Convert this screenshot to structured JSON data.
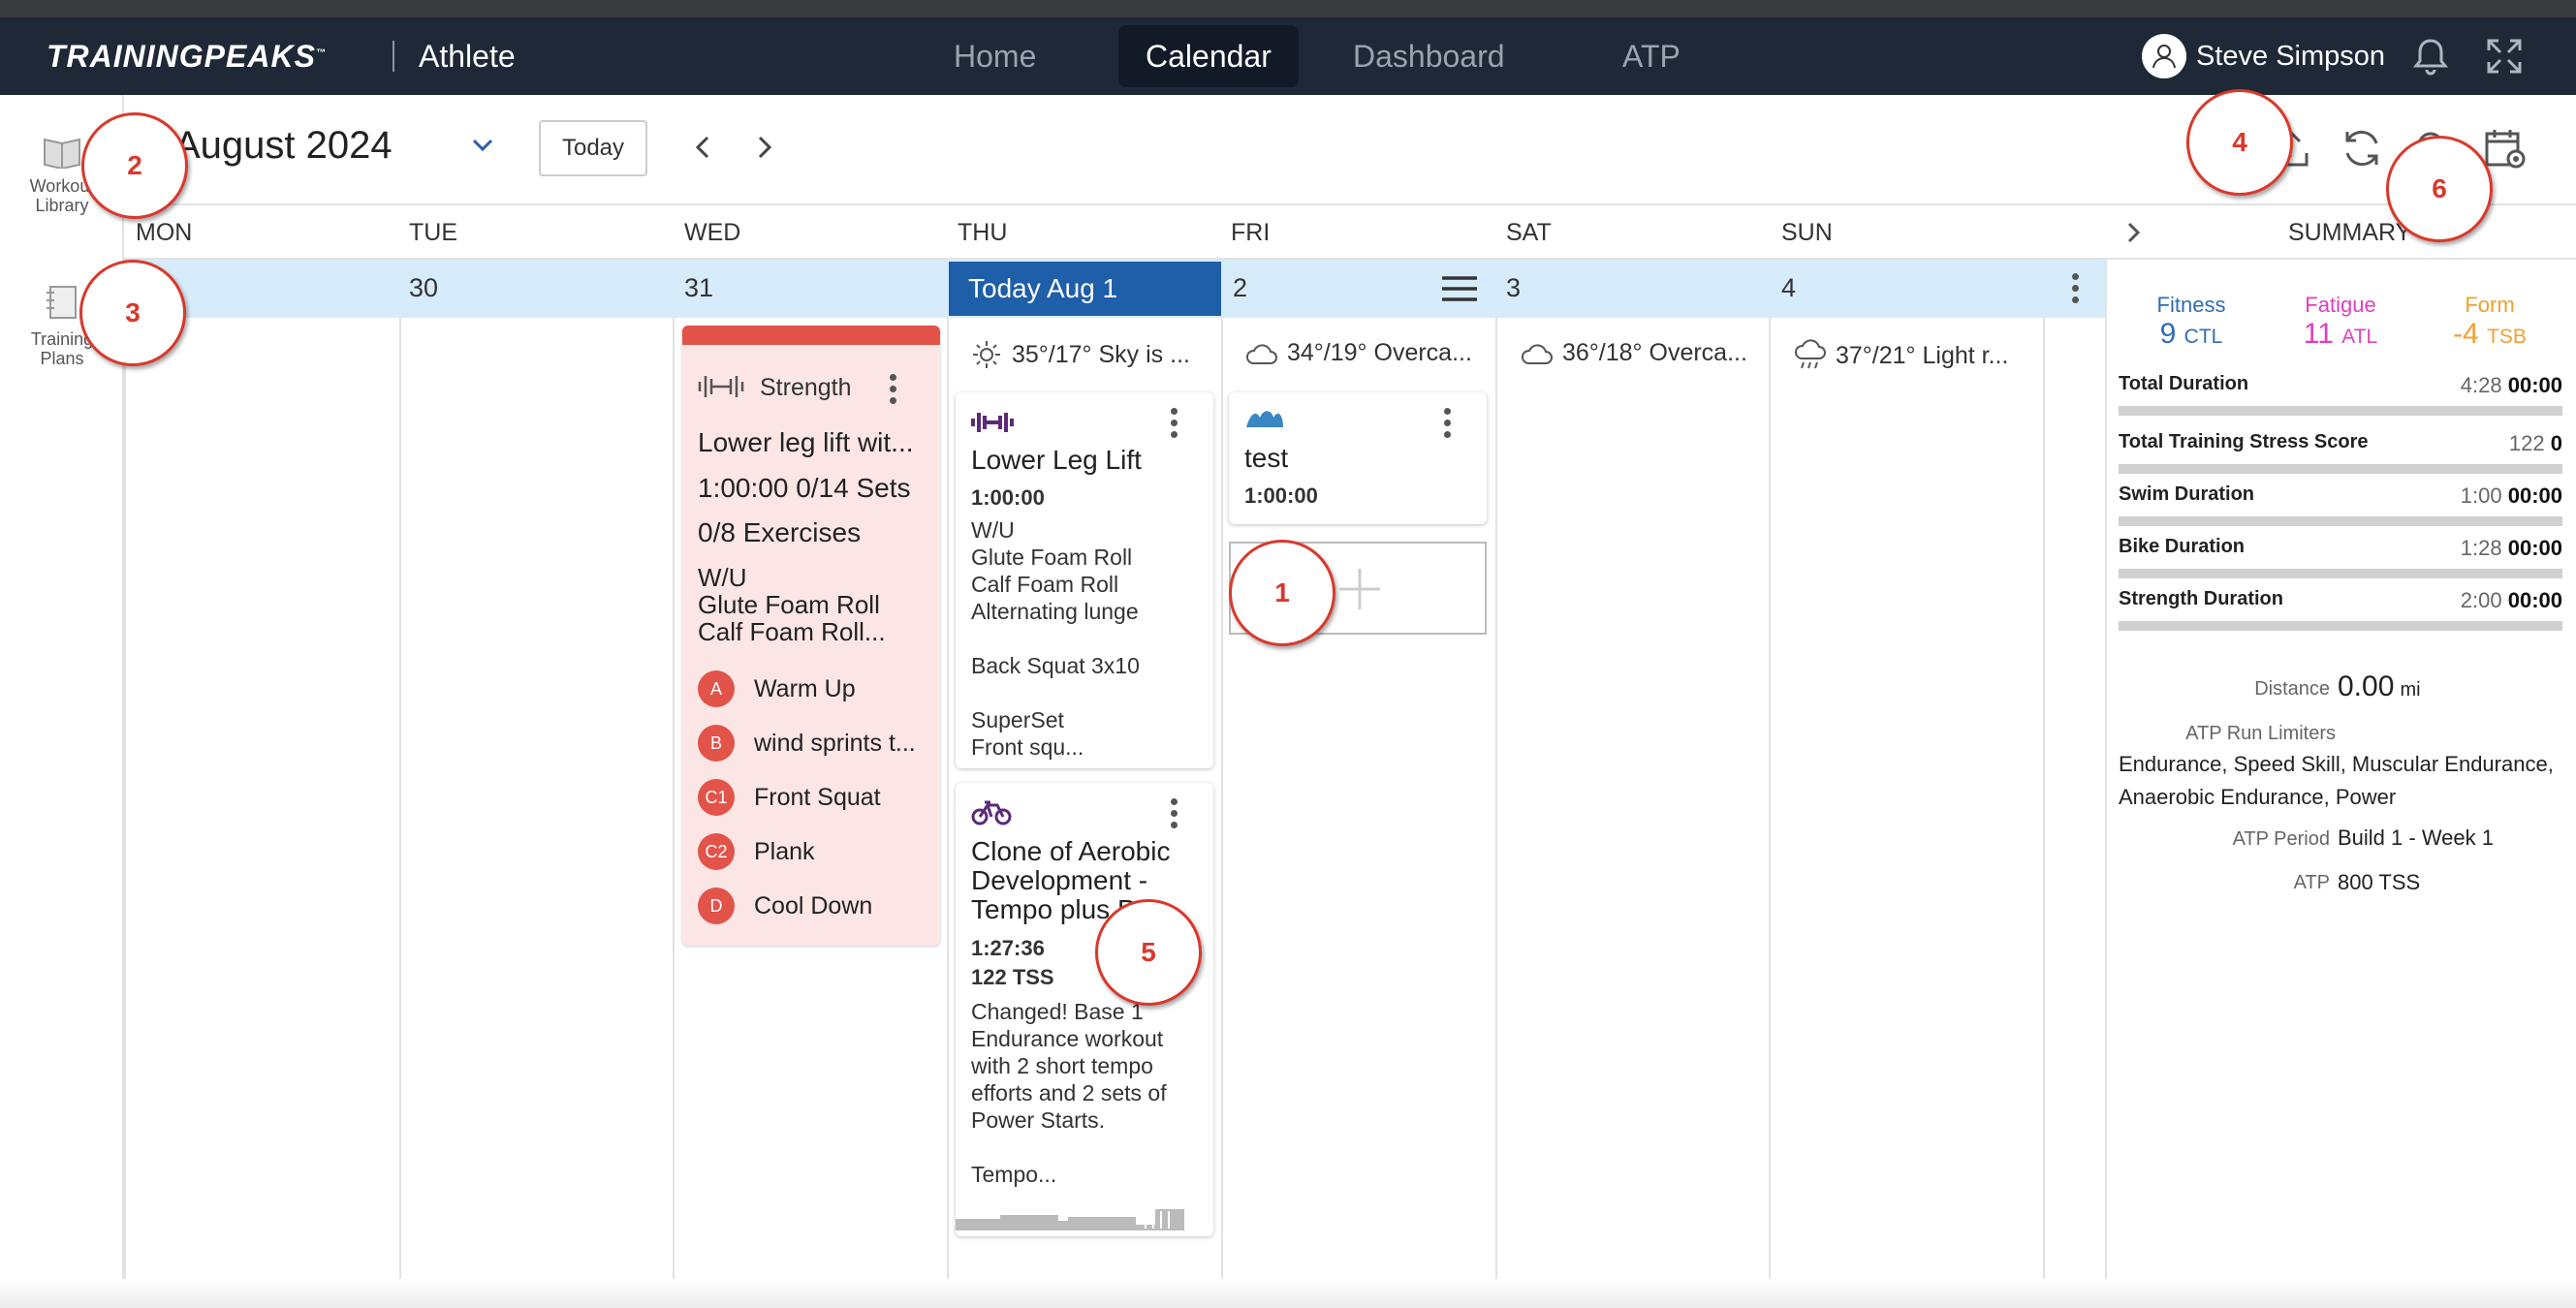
{
  "app": {
    "logo": "TRAININGPEAKS",
    "logo_tm": "™",
    "section": "Athlete"
  },
  "nav": {
    "home": "Home",
    "calendar": "Calendar",
    "dashboard": "Dashboard",
    "atp": "ATP"
  },
  "user": {
    "name": "Steve Simpson"
  },
  "sidebar": {
    "workout_library_1": "Workout",
    "workout_library_2": "Library",
    "training_plans_1": "Training",
    "training_plans_2": "Plans"
  },
  "toolbar": {
    "month": "August 2024",
    "today": "Today"
  },
  "days": {
    "mon": "MON",
    "tue": "TUE",
    "wed": "WED",
    "thu": "THU",
    "fri": "FRI",
    "sat": "SAT",
    "sun": "SUN",
    "summary": "SUMMARY"
  },
  "dates": {
    "tue": "30",
    "wed": "31",
    "thu": "Today Aug 1",
    "fri": "2",
    "sat": "3",
    "sun": "4"
  },
  "weather": {
    "thu": "35°/17° Sky is ...",
    "fri": "34°/19° Overca...",
    "sat": "36°/18° Overca...",
    "sun": "37°/21° Light r..."
  },
  "strength_card": {
    "type": "Strength",
    "title": "Lower leg lift wit...",
    "sets": "1:00:00 0/14 Sets",
    "exercises": "0/8 Exercises",
    "desc1": "W/U",
    "desc2": "Glute Foam Roll",
    "desc3": "Calf Foam Roll...",
    "items": [
      {
        "badge": "A",
        "label": "Warm Up"
      },
      {
        "badge": "B",
        "label": "wind sprints t..."
      },
      {
        "badge": "C1",
        "label": "Front Squat"
      },
      {
        "badge": "C2",
        "label": "Plank"
      },
      {
        "badge": "D",
        "label": "Cool Down"
      }
    ]
  },
  "lower_leg_card": {
    "title": "Lower Leg Lift",
    "duration": "1:00:00",
    "desc": "W/U\nGlute Foam Roll\nCalf Foam Roll\nAlternating lunge\n\nBack Squat 3x10\n\nSuperSet\nFront squ..."
  },
  "aerobic_card": {
    "title": "Clone of Aerobic Development - Tempo plus P...",
    "duration": "1:27:36",
    "tss": "122 TSS",
    "desc": "Changed! Base 1 Endurance workout with 2 short tempo efforts and 2 sets of Power Starts.\n\nTempo..."
  },
  "swim_card": {
    "title": "test",
    "duration": "1:00:00"
  },
  "summary": {
    "fitness_label": "Fitness",
    "fitness_value": "9",
    "fitness_unit": "CTL",
    "fatigue_label": "Fatigue",
    "fatigue_value": "11",
    "fatigue_unit": "ATL",
    "form_label": "Form",
    "form_value": "-4",
    "form_unit": "TSB",
    "rows": [
      {
        "label": "Total Duration",
        "planned": "4:28",
        "completed": "00:00"
      },
      {
        "label": "Total Training Stress Score",
        "planned": "122",
        "completed": "0"
      },
      {
        "label": "Swim Duration",
        "planned": "1:00",
        "completed": "00:00"
      },
      {
        "label": "Bike Duration",
        "planned": "1:28",
        "completed": "00:00"
      },
      {
        "label": "Strength Duration",
        "planned": "2:00",
        "completed": "00:00"
      }
    ],
    "distance_label": "Distance",
    "distance_value": "0.00",
    "distance_unit": "mi",
    "limiters_label": "ATP Run Limiters",
    "limiters_value": "Endurance, Speed Skill, Muscular Endurance, Anaerobic Endurance, Power",
    "period_label": "ATP Period",
    "period_value": "Build 1 - Week 1",
    "atp_label": "ATP",
    "atp_value": "800 TSS"
  },
  "annotations": [
    "1",
    "2",
    "3",
    "4",
    "5",
    "6"
  ],
  "colors": {
    "topbar": "#1f2836",
    "today": "#1f5ea8",
    "week_row": "#d7ecfb",
    "strength": "#e2534a",
    "fitness": "#2f6db3",
    "fatigue": "#e03fbf",
    "form": "#f0a030",
    "annotation": "#d9392c"
  }
}
